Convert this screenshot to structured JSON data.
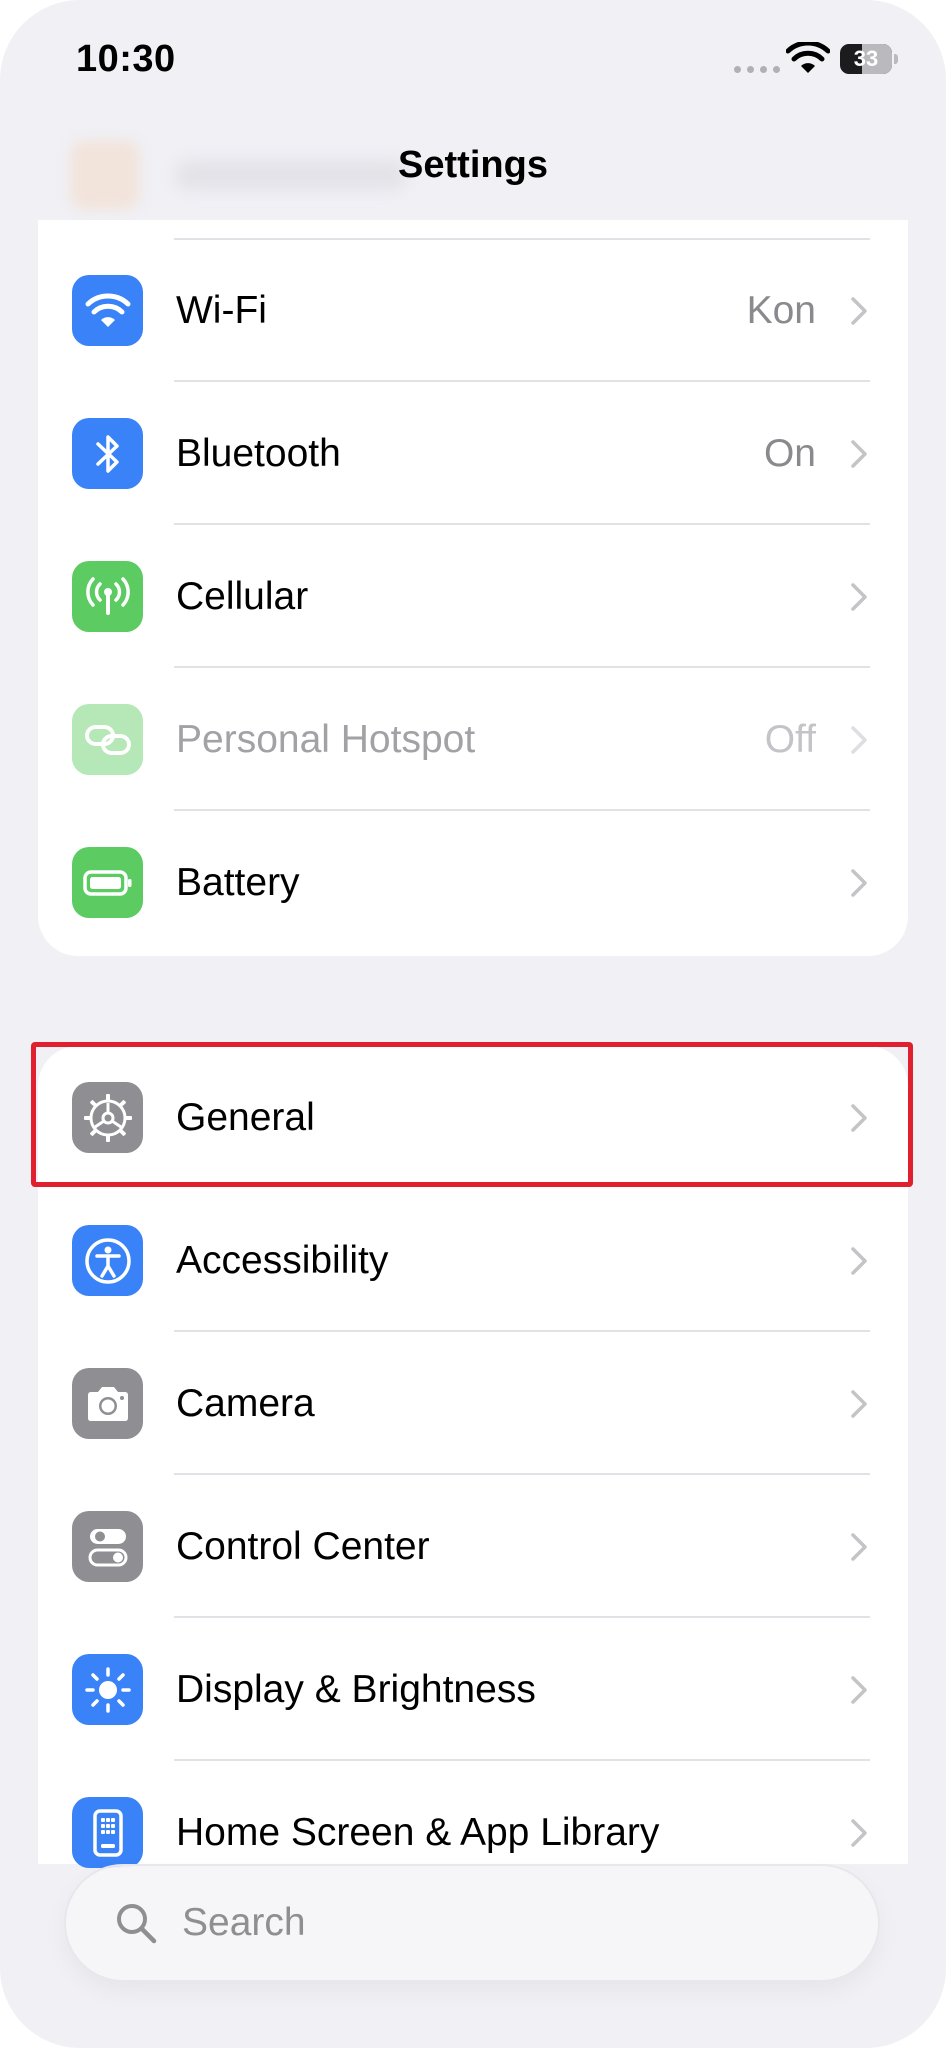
{
  "status_bar": {
    "time": "10:30",
    "battery_level": "33"
  },
  "nav": {
    "title": "Settings"
  },
  "group1": [
    {
      "label": "Wi-Fi",
      "value": "Kon",
      "icon": "wifi-icon",
      "color": "#3a82f7"
    },
    {
      "label": "Bluetooth",
      "value": "On",
      "icon": "bluetooth-icon",
      "color": "#3a82f7"
    },
    {
      "label": "Cellular",
      "value": "",
      "icon": "antenna-icon",
      "color": "#5ccb62"
    },
    {
      "label": "Personal Hotspot",
      "value": "Off",
      "icon": "link-icon",
      "color": "#5ccb62",
      "disabled": true
    },
    {
      "label": "Battery",
      "value": "",
      "icon": "battery-icon",
      "color": "#5ccb62"
    }
  ],
  "group2": [
    {
      "label": "General",
      "icon": "gear-icon",
      "color": "#8e8e93",
      "highlighted": true
    },
    {
      "label": "Accessibility",
      "icon": "accessibility-icon",
      "color": "#3a82f7"
    },
    {
      "label": "Camera",
      "icon": "camera-icon",
      "color": "#8e8e93"
    },
    {
      "label": "Control Center",
      "icon": "toggles-icon",
      "color": "#8e8e93"
    },
    {
      "label": "Display & Brightness",
      "icon": "sun-icon",
      "color": "#3a82f7"
    },
    {
      "label": "Home Screen & App Library",
      "icon": "phone-grid-icon",
      "color": "#3a82f7"
    }
  ],
  "search": {
    "placeholder": "Search"
  },
  "highlight_color": "#e0202e"
}
